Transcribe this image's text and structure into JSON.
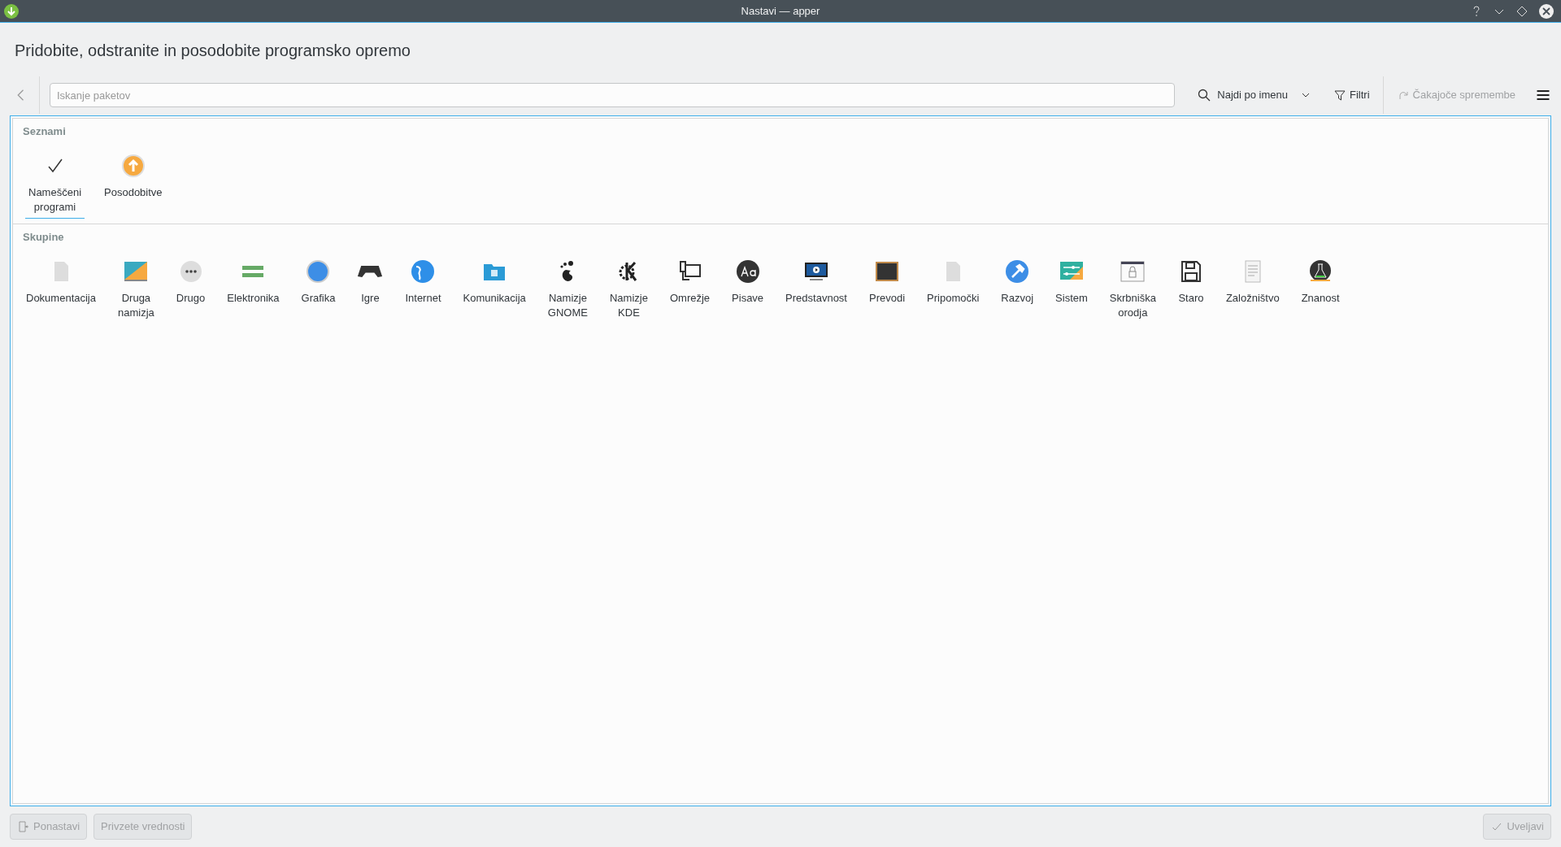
{
  "window": {
    "title": "Nastavi — apper"
  },
  "heading": "Pridobite, odstranite in posodobite programsko opremo",
  "search": {
    "placeholder": "Iskanje paketov"
  },
  "toolbar": {
    "find_by": "Najdi po imenu",
    "filters": "Filtri",
    "pending": "Čakajoče spremembe"
  },
  "lists": {
    "title": "Seznami",
    "items": [
      {
        "label": "Nameščeni\nprogrami",
        "kind": "check",
        "selected": true
      },
      {
        "label": "Posodobitve",
        "kind": "update",
        "selected": false
      }
    ]
  },
  "groups": {
    "title": "Skupine",
    "items": [
      {
        "label": "Dokumentacija",
        "kind": "doc"
      },
      {
        "label": "Druga\nnamizja",
        "kind": "desktop"
      },
      {
        "label": "Drugo",
        "kind": "dots"
      },
      {
        "label": "Elektronika",
        "kind": "board"
      },
      {
        "label": "Grafika",
        "kind": "sphere"
      },
      {
        "label": "Igre",
        "kind": "gamepad"
      },
      {
        "label": "Internet",
        "kind": "globe"
      },
      {
        "label": "Komunikacija",
        "kind": "folder"
      },
      {
        "label": "Namizje\nGNOME",
        "kind": "foot"
      },
      {
        "label": "Namizje\nKDE",
        "kind": "kde"
      },
      {
        "label": "Omrežje",
        "kind": "network"
      },
      {
        "label": "Pisave",
        "kind": "font"
      },
      {
        "label": "Predstavnost",
        "kind": "monitor"
      },
      {
        "label": "Prevodi",
        "kind": "board2"
      },
      {
        "label": "Pripomočki",
        "kind": "doc"
      },
      {
        "label": "Razvoj",
        "kind": "hammer"
      },
      {
        "label": "Sistem",
        "kind": "settings"
      },
      {
        "label": "Skrbniška\norodja",
        "kind": "lock"
      },
      {
        "label": "Staro",
        "kind": "floppy"
      },
      {
        "label": "Založništvo",
        "kind": "text"
      },
      {
        "label": "Znanost",
        "kind": "flask"
      }
    ]
  },
  "buttons": {
    "reset": "Ponastavi",
    "defaults": "Privzete vrednosti",
    "apply": "Uveljavi"
  }
}
